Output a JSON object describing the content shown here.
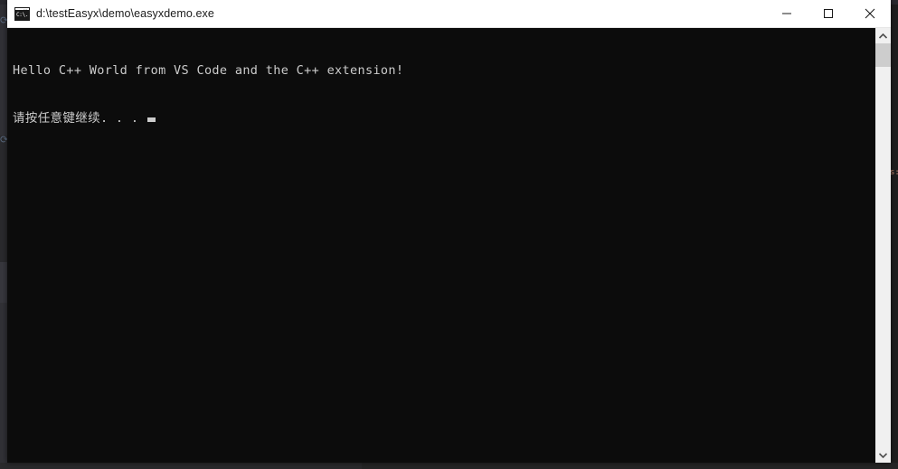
{
  "window": {
    "title": "d:\\testEasyx\\demo\\easyxdemo.exe",
    "icon_name": "console-app-icon",
    "icon_glyph": "C:\\.",
    "icon_dots": "···",
    "controls": {
      "minimize_label": "Minimize",
      "maximize_label": "Maximize",
      "close_label": "Close"
    }
  },
  "console": {
    "background_color": "#0c0c0c",
    "foreground_color": "#cccccc",
    "lines": [
      "Hello C++ World from VS Code and the C++ extension!",
      "请按任意键继续. . . "
    ],
    "cursor_visible": true
  },
  "scrollbar": {
    "up_arrow_label": "Scroll up",
    "down_arrow_label": "Scroll down",
    "thumb_label": "Scroll thumb"
  },
  "backdrop": {
    "app_hint": "VS Code editor behind",
    "right_code_fragment": "s:\nr",
    "accent_color": "#ce9178",
    "editor_bg": "#1e1e1e",
    "activity_bar_bg": "#313136",
    "panel_bg": "#252526"
  }
}
